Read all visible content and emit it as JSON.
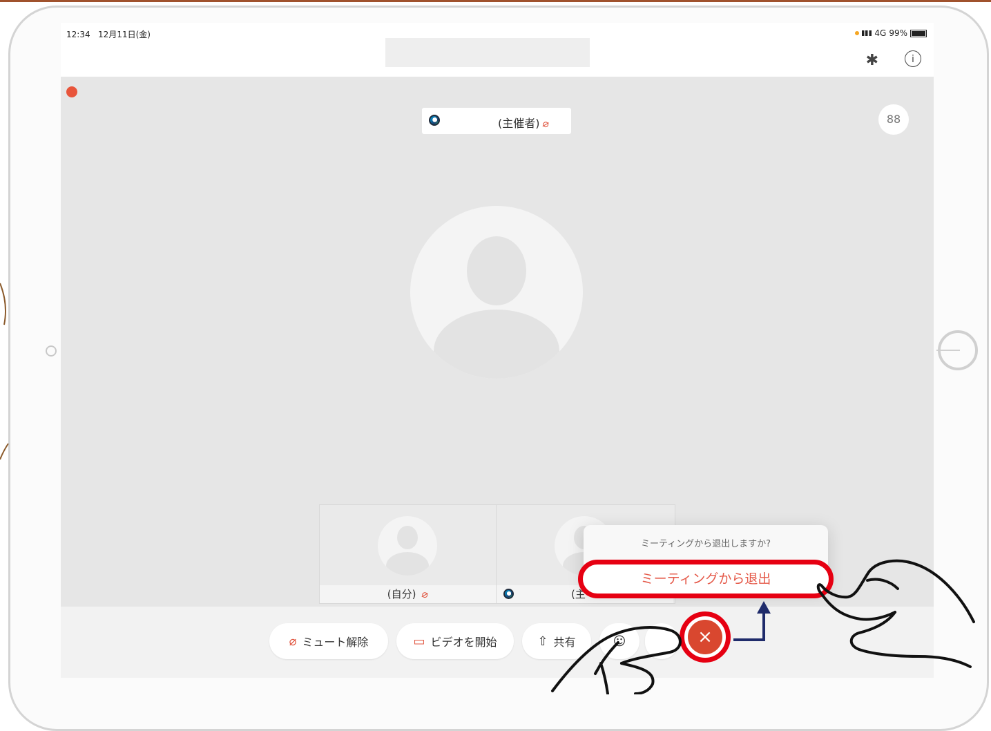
{
  "status_bar": {
    "time": "12:34",
    "date": "12月11日(金)",
    "network": "4G",
    "battery": "99%"
  },
  "icons": {
    "bluetooth": "bluetooth-icon",
    "info": "info-icon",
    "layout": "grid-layout-icon",
    "mic_off": "mic-off-icon",
    "video_off": "video-off-icon",
    "share": "share-icon",
    "participants": "participants-icon",
    "end": "close-icon"
  },
  "main_video": {
    "name_tag": "(主催者)"
  },
  "thumbnails": [
    {
      "label": "(自分)"
    },
    {
      "label": "(主"
    }
  ],
  "dialog": {
    "question": "ミーティングから退出しますか?",
    "leave_label": "ミーティングから退出"
  },
  "toolbar": {
    "unmute": "ミュート解除",
    "start_video": "ビデオを開始",
    "share": "共有"
  },
  "colors": {
    "highlight_red": "#e60012",
    "end_button": "#d9472f",
    "arrow_navy": "#1f2b6b",
    "mic_off_red": "#e0533d"
  }
}
